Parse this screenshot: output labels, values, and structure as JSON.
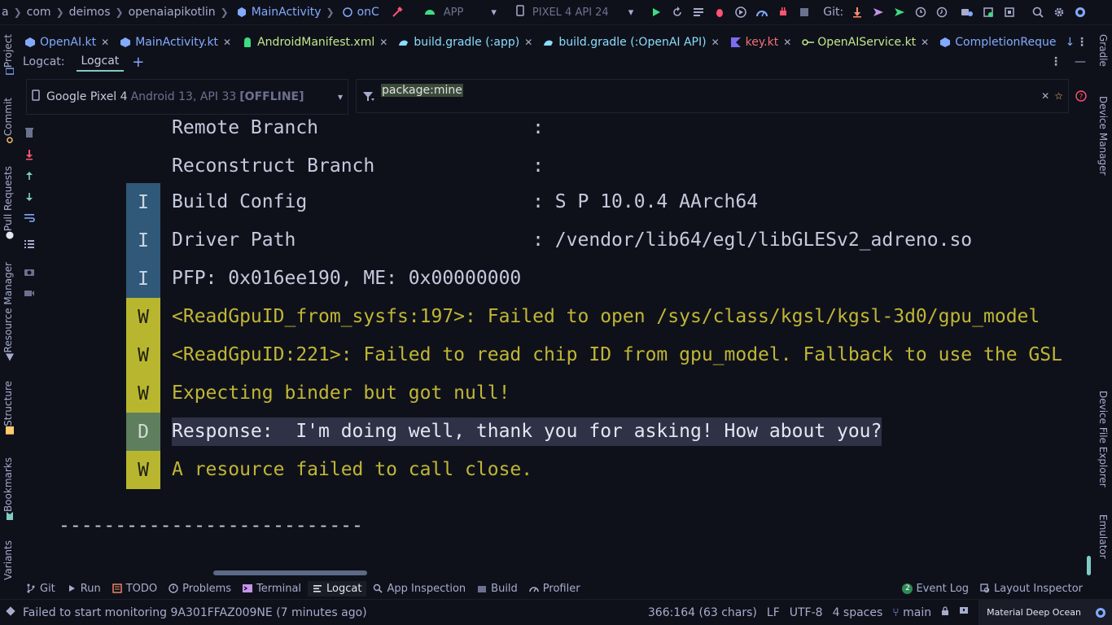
{
  "breadcrumbs": {
    "items": [
      "a",
      "com",
      "deimos",
      "openaiapikotlin",
      "MainActivity",
      "onC"
    ],
    "git_label": "Git:"
  },
  "toolbar": {
    "run_config": "APP",
    "device": "PIXEL 4 API 24"
  },
  "tabs": [
    {
      "label": "OpenAI.kt",
      "icon": "kotlin-file-icon"
    },
    {
      "label": "MainActivity.kt",
      "icon": "kotlin-class-icon"
    },
    {
      "label": "AndroidManifest.xml",
      "icon": "android-manifest-icon"
    },
    {
      "label": "build.gradle (:app)",
      "icon": "gradle-icon"
    },
    {
      "label": "build.gradle (:OpenAI API)",
      "icon": "gradle-icon"
    },
    {
      "label": "key.kt",
      "icon": "kotlin-file-icon"
    },
    {
      "label": "OpenAIService.kt",
      "icon": "interface-icon"
    },
    {
      "label": "CompletionReque",
      "icon": "kotlin-class-icon"
    }
  ],
  "logcat": {
    "title": "Logcat:",
    "tab": "Logcat",
    "device_name": "Google Pixel 4",
    "device_meta": "Android 13, API 33",
    "device_status": "[OFFLINE]",
    "filter": "package:mine",
    "rows": [
      {
        "level": "",
        "message": "Remote Branch                   :"
      },
      {
        "level": "",
        "message": "Reconstruct Branch              :"
      },
      {
        "level": "I",
        "message": "Build Config                    : S P 10.0.4 AArch64"
      },
      {
        "level": "I",
        "message": "Driver Path                     : /vendor/lib64/egl/libGLESv2_adreno.so"
      },
      {
        "level": "I",
        "message": "PFP: 0x016ee190, ME: 0x00000000"
      },
      {
        "level": "W",
        "message": "<ReadGpuID_from_sysfs:197>: Failed to open /sys/class/kgsl/kgsl-3d0/gpu_model"
      },
      {
        "level": "W",
        "message": "<ReadGpuID:221>: Failed to read chip ID from gpu_model. Fallback to use the GSL"
      },
      {
        "level": "W",
        "message": "Expecting binder but got null!"
      },
      {
        "level": "D",
        "message": "Response:  I'm doing well, thank you for asking! How about you?"
      },
      {
        "level": "W",
        "message": "A resource failed to call close."
      }
    ],
    "separator": "---------------------------"
  },
  "left_sidebar": [
    "Project",
    "Commit",
    "Pull Requests",
    "Resource Manager",
    "Structure",
    "Bookmarks",
    "Variants"
  ],
  "right_sidebar": [
    "Gradle",
    "Device Manager",
    "Device File Explorer",
    "Emulator"
  ],
  "bottom_tools": {
    "left": [
      "Git",
      "Run",
      "TODO",
      "Problems",
      "Terminal",
      "Logcat",
      "App Inspection",
      "Build",
      "Profiler"
    ],
    "event_log": "Event Log",
    "event_count": "2",
    "layout_inspector": "Layout Inspector"
  },
  "status": {
    "message": "Failed to start monitoring 9A301FFAZ009NE (7 minutes ago)",
    "position": "366:164 (63 chars)",
    "line_sep": "LF",
    "encoding": "UTF-8",
    "indent": "4 spaces",
    "branch": "main",
    "theme": "Material Deep Ocean"
  }
}
